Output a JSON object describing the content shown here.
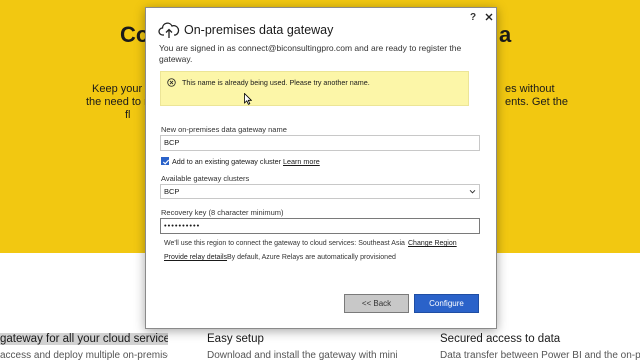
{
  "background": {
    "heading_left": "Co",
    "heading_right": "a",
    "para_left_1": "Keep your d",
    "para_left_2": "the need to m",
    "para_left_3": "fl",
    "para_right_1": "es without",
    "para_right_2": "ents. Get the",
    "features": [
      {
        "title": "gateway for all your cloud services",
        "text": "access and deploy multiple on-premises data"
      },
      {
        "title": "Easy setup",
        "text": "Download and install the gateway with minimal"
      },
      {
        "title": "Secured access to data",
        "text": "Data transfer between Power BI and the on-premises"
      }
    ],
    "colors": {
      "hero": "#f2c811"
    }
  },
  "dialog": {
    "title": "On-premises data gateway",
    "icon": "cloud-upload-icon",
    "help": "?",
    "close": "close-icon",
    "signed_in_text": "You are signed in as connect@biconsultingpro.com and are ready to register the gateway.",
    "warning": {
      "icon": "error-circle-icon",
      "text": "This name is already being used. Please try another name."
    },
    "name_label": "New on-premises data gateway name",
    "name_value": "BCP",
    "add_cluster": {
      "checked": true,
      "label": "Add to an existing gateway cluster",
      "link": "Learn more"
    },
    "clusters_label": "Available gateway clusters",
    "clusters_selected": "BCP",
    "recovery_label": "Recovery key (8 character minimum)",
    "recovery_value": "••••••••••",
    "region_text": "We'll use this region to connect the gateway to cloud services: Southeast Asia",
    "region_link": "Change Region",
    "relay_link": "Provide relay details",
    "relay_text": "By default, Azure Relays are automatically provisioned",
    "back_button": "<< Back",
    "configure_button": "Configure",
    "colors": {
      "primary": "#2a62c9",
      "warning_bg": "#fcf6a8"
    }
  }
}
